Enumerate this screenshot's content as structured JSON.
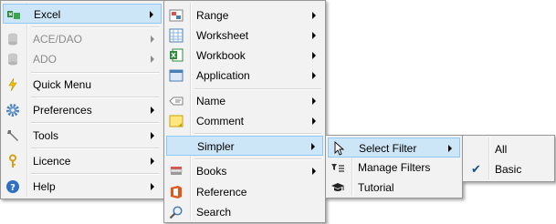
{
  "menu_main": {
    "items": [
      {
        "label": "Excel",
        "icon": "excel-addin-icon"
      },
      {
        "label": "ACE/DAO",
        "icon": "database-icon"
      },
      {
        "label": "ADO",
        "icon": "database-icon"
      },
      {
        "label": "Quick Menu",
        "icon": "lightning-icon"
      },
      {
        "label": "Preferences",
        "icon": "gear-icon"
      },
      {
        "label": "Tools",
        "icon": "wrench-icon"
      },
      {
        "label": "Licence",
        "icon": "key-icon"
      },
      {
        "label": "Help",
        "icon": "help-icon"
      }
    ]
  },
  "menu_excel": {
    "items": [
      {
        "label": "Range",
        "icon": "range-icon"
      },
      {
        "label": "Worksheet",
        "icon": "worksheet-icon"
      },
      {
        "label": "Workbook",
        "icon": "workbook-icon"
      },
      {
        "label": "Application",
        "icon": "application-icon"
      },
      {
        "label": "Name",
        "icon": "name-tag-icon"
      },
      {
        "label": "Comment",
        "icon": "comment-icon"
      },
      {
        "label": "Simpler",
        "icon": ""
      },
      {
        "label": "Books",
        "icon": "books-icon"
      },
      {
        "label": "Reference",
        "icon": "office-icon"
      },
      {
        "label": "Search",
        "icon": "magnifier-icon"
      }
    ]
  },
  "menu_simpler": {
    "items": [
      {
        "label": "Select Filter",
        "icon": "cursor-arrow-icon"
      },
      {
        "label": "Manage Filters",
        "icon": "filter-list-icon"
      },
      {
        "label": "Tutorial",
        "icon": "graduation-cap-icon"
      }
    ]
  },
  "menu_filter": {
    "items": [
      {
        "label": "All",
        "checked": false
      },
      {
        "label": "Basic",
        "checked": true
      }
    ]
  },
  "colors": {
    "highlight_bg": "#cde6f7",
    "highlight_border": "#90c8f6",
    "menu_bg": "#f2f2f2",
    "disabled_text": "#8c8c8c"
  }
}
